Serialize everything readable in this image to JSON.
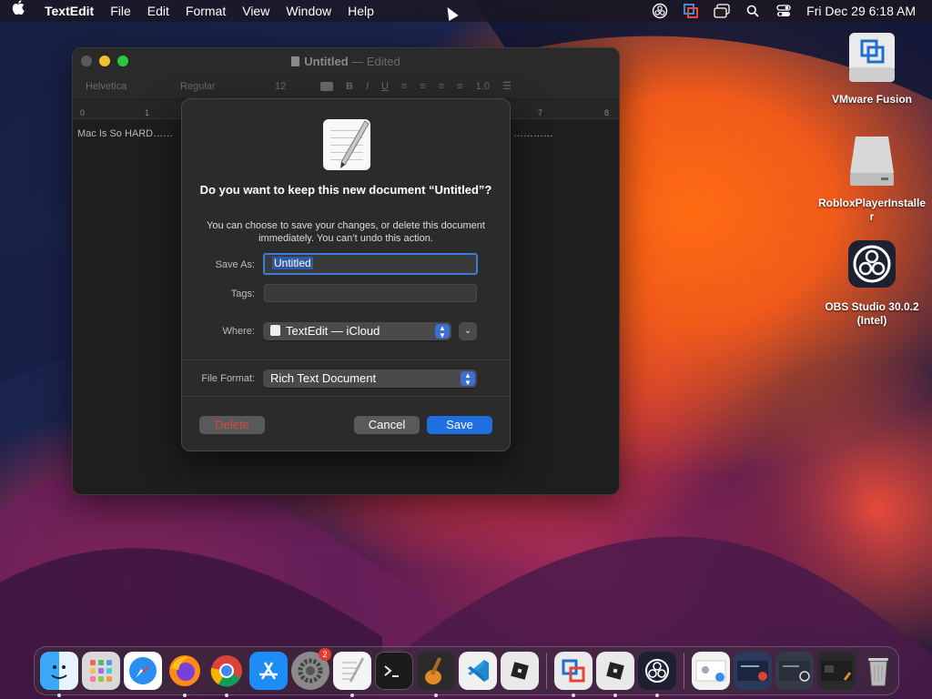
{
  "menubar": {
    "app_name": "TextEdit",
    "menus": [
      "File",
      "Edit",
      "Format",
      "View",
      "Window",
      "Help"
    ],
    "clock": "Fri Dec 29  6:18 AM",
    "status_icons": [
      "obs-icon",
      "vmware-icon",
      "screen-mirroring-icon",
      "search-icon",
      "control-center-icon"
    ]
  },
  "window": {
    "title": "Untitled",
    "title_suffix": "— Edited",
    "toolbar": {
      "font_family": "Helvetica",
      "font_style": "Regular",
      "font_size": "12",
      "line_spacing": "1.0"
    },
    "ruler_marks": [
      "0",
      "1",
      "7",
      "8"
    ],
    "document_text": "Mac Is So HARD……",
    "document_dots": "…………"
  },
  "sheet": {
    "title": "Do you want to keep this new document “Untitled”?",
    "message": "You can choose to save your changes, or delete this document immediately. You can’t undo this action.",
    "save_as_label": "Save As:",
    "save_as_value": "Untitled",
    "tags_label": "Tags:",
    "tags_value": "",
    "where_label": "Where:",
    "where_value": "TextEdit — iCloud",
    "file_format_label": "File Format:",
    "file_format_value": "Rich Text Document",
    "delete_button": "Delete",
    "cancel_button": "Cancel",
    "save_button": "Save"
  },
  "desktop_icons": [
    {
      "label": "VMware Fusion",
      "icon": "vmware-fusion-icon"
    },
    {
      "label": "RobloxPlayerInstaller",
      "icon": "disk-image-icon"
    },
    {
      "label": "OBS Studio 30.0.2 (Intel)",
      "icon": "obs-studio-icon"
    }
  ],
  "dock": {
    "apps": [
      "Finder",
      "Launchpad",
      "Safari",
      "Firefox",
      "Chrome",
      "App Store",
      "System Settings",
      "TextEdit",
      "Terminal",
      "GarageBand",
      "VS Code",
      "Roblox",
      "VMware Fusion",
      "Roblox",
      "OBS Studio"
    ],
    "settings_badge": "2",
    "trash": "Trash"
  },
  "colors": {
    "accent": "#1f6fe0",
    "delete_red": "#d84a3a",
    "window_bg": "#1e1e1e",
    "sheet_bg": "#2b2b2b"
  }
}
